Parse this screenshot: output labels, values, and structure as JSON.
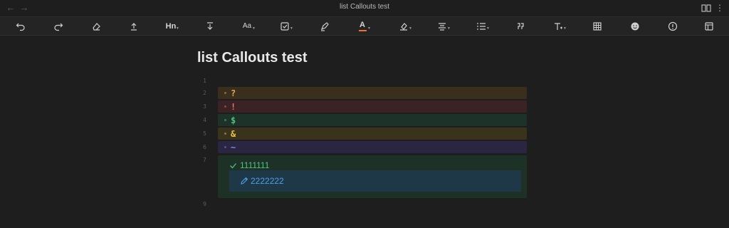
{
  "window": {
    "title": "list Callouts test"
  },
  "toolbar": {
    "tools": [
      "undo-icon",
      "redo-icon",
      "eraser-icon",
      "upload-icon",
      "heading-icon",
      "download-icon",
      "font-size-icon",
      "checkbox-icon",
      "highlighter-icon",
      "font-color-icon",
      "fill-color-icon",
      "align-icon",
      "list-icon",
      "quote-icon",
      "text-format-icon",
      "table-icon",
      "emoji-icon",
      "info-icon",
      "layout-icon"
    ],
    "heading_label": "Hn",
    "fontsize_label": "Aa",
    "fontcolor_label": "A"
  },
  "document": {
    "title": "list Callouts test",
    "line_numbers": [
      "1",
      "2",
      "3",
      "4",
      "5",
      "6",
      "7",
      "9"
    ],
    "callouts": [
      {
        "symbol": "?",
        "bg": "#3a2e1d",
        "color": "#e8a94a",
        "bullet": "#8a6a3a"
      },
      {
        "symbol": "!",
        "bg": "#3a2225",
        "color": "#e57373",
        "bullet": "#8a4a4a"
      },
      {
        "symbol": "$",
        "bg": "#1d3329",
        "color": "#4ec27c",
        "bullet": "#3f7a58"
      },
      {
        "symbol": "&",
        "bg": "#39331c",
        "color": "#e8c04a",
        "bullet": "#8a7a3a"
      },
      {
        "symbol": "~",
        "bg": "#2a2540",
        "color": "#7f8ce8",
        "bullet": "#55558a"
      }
    ],
    "nested": {
      "check_text": "1111111",
      "pencil_text": "2222222",
      "check_color": "#4ec27c",
      "pencil_color": "#4d9fe6"
    }
  }
}
